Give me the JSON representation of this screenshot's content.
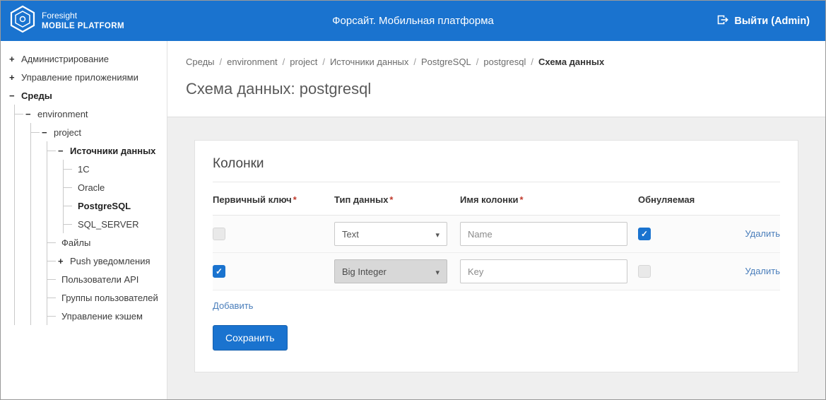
{
  "topbar": {
    "brand": {
      "line1": "Foresight",
      "line2": "MOBILE PLATFORM"
    },
    "title": "Форсайт. Мобильная платформа",
    "logout": "Выйти (Admin)"
  },
  "sidebar": {
    "items": [
      {
        "label": "Администрирование",
        "toggle": "+"
      },
      {
        "label": "Управление приложениями",
        "toggle": "+"
      },
      {
        "label": "Среды",
        "toggle": "−"
      },
      {
        "label": "environment",
        "toggle": "−"
      },
      {
        "label": "project",
        "toggle": "−"
      },
      {
        "label": "Источники данных",
        "toggle": "−"
      },
      {
        "label": "1C"
      },
      {
        "label": "Oracle"
      },
      {
        "label": "PostgreSQL"
      },
      {
        "label": "SQL_SERVER"
      },
      {
        "label": "Файлы"
      },
      {
        "label": "Push уведомления",
        "toggle": "+"
      },
      {
        "label": "Пользователи API"
      },
      {
        "label": "Группы пользователей"
      },
      {
        "label": "Управление кэшем"
      }
    ]
  },
  "breadcrumb": {
    "separator": "/",
    "items": [
      {
        "label": "Среды"
      },
      {
        "label": "environment"
      },
      {
        "label": "project"
      },
      {
        "label": "Источники данных"
      },
      {
        "label": "PostgreSQL"
      },
      {
        "label": "postgresql"
      },
      {
        "label": "Схема данных"
      }
    ]
  },
  "page": {
    "title": "Схема данных: postgresql"
  },
  "panel": {
    "title": "Колонки",
    "headers": {
      "primary_key": "Первичный ключ",
      "data_type": "Тип данных",
      "column_name": "Имя колонки",
      "nullable": "Обнуляемая"
    },
    "rows": [
      {
        "primary_key": false,
        "primary_key_disabled": true,
        "data_type": "Text",
        "data_type_disabled": false,
        "column_name": "Name",
        "nullable": true,
        "nullable_disabled": false,
        "delete_label": "Удалить"
      },
      {
        "primary_key": true,
        "primary_key_disabled": false,
        "data_type": "Big Integer",
        "data_type_disabled": true,
        "column_name": "Key",
        "nullable": false,
        "nullable_disabled": true,
        "delete_label": "Удалить"
      }
    ],
    "add_label": "Добавить",
    "save_label": "Сохранить"
  },
  "colors": {
    "accent": "#1a73cf",
    "link": "#4a7ebb"
  }
}
